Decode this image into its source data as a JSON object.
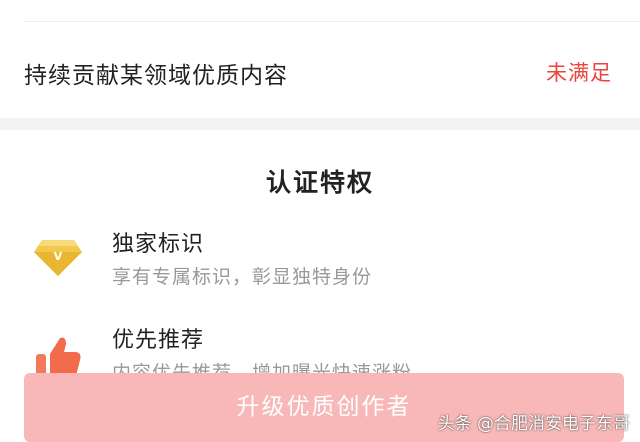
{
  "requirement": {
    "label": "持续贡献某领域优质内容",
    "status": "未满足",
    "status_color": "#e8453c"
  },
  "privileges": {
    "title": "认证特权",
    "items": [
      {
        "name": "独家标识",
        "desc": "享有专属标识，彰显独特身份",
        "icon": "diamond-v-badge-icon"
      },
      {
        "name": "优先推荐",
        "desc": "内容优先推荐，增加曝光快速涨粉",
        "icon": "thumbs-up-icon"
      }
    ]
  },
  "upgrade_button": {
    "label": "升级优质创作者",
    "color": "#f8b8b8"
  },
  "watermark": "头条 @合肥消安电子东哥"
}
